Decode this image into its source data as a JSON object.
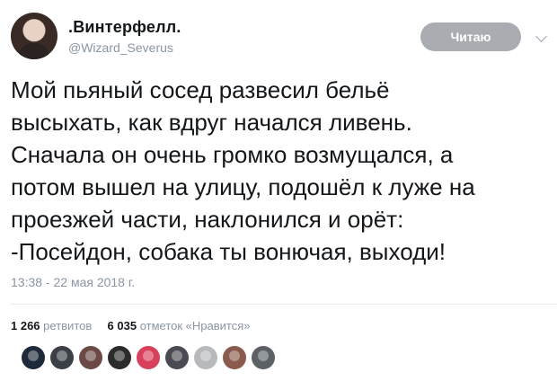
{
  "tweet": {
    "author": {
      "display_name": ".Винтерфелл.",
      "handle": "@Wizard_Severus"
    },
    "follow_button_label": "Читаю",
    "text_lines": [
      "Мой пьяный сосед развесил бельё",
      "высыхать, как вдруг начался ливень.",
      "Сначала он очень громко возмущался, а",
      "потом вышел на улицу, подошёл к луже на",
      "проезжей части, наклонился и орёт:",
      "-Посейдон, собака ты вонючая, выходи!"
    ],
    "timestamp": "13:38 - 22 мая 2018 г.",
    "stats": {
      "retweets_count": "1 266",
      "retweets_label": "ретвитов",
      "likes_count": "6 035",
      "likes_label": "отметок «Нравится»"
    },
    "liker_avatars": [
      {
        "icon": "user-avatar",
        "color": "#1e2a3a"
      },
      {
        "icon": "user-avatar",
        "color": "#3b3f46"
      },
      {
        "icon": "user-avatar",
        "color": "#6b4a46"
      },
      {
        "icon": "user-avatar",
        "color": "#2b2b2b"
      },
      {
        "icon": "user-avatar",
        "color": "#d7415c"
      },
      {
        "icon": "user-avatar",
        "color": "#4a4a52"
      },
      {
        "icon": "user-avatar",
        "color": "#b7b9bd"
      },
      {
        "icon": "user-avatar",
        "color": "#8a5a4c"
      },
      {
        "icon": "user-avatar",
        "color": "#5c6166"
      }
    ]
  }
}
